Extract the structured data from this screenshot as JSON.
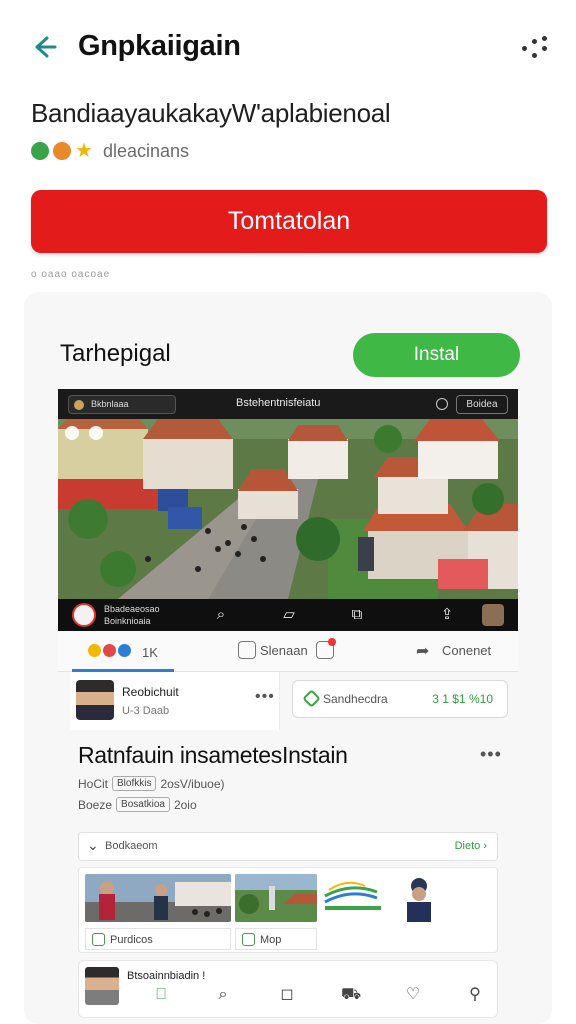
{
  "header": {
    "back_icon": "arrow-left-icon",
    "title": "Gnpkaiigain",
    "more_icon": "share-dots-icon"
  },
  "subtitle": "BandiaayaukakayW'aplabienoal",
  "meta": {
    "text": "dleacinans",
    "dots": [
      "#3aa34a",
      "#e8892a",
      "#f2b705"
    ]
  },
  "cta": {
    "label": "Tomtatolan"
  },
  "caption": "o oaao oacoae",
  "card": {
    "title": "Tarhepigal",
    "install_label": "Instal",
    "colors": {
      "install": "#3fb846",
      "cta": "#e31b1b"
    }
  },
  "media": {
    "chip_left": "Bkbnlaaa",
    "title": "Bstehentnisfeiatu",
    "chip_right": "Boidea",
    "channel_line1": "Bbadeaeosao",
    "channel_line2": "Boinknioaia",
    "icons": [
      "search-icon",
      "bookmark-icon",
      "save-icon",
      "share-icon"
    ]
  },
  "reactions": {
    "count": "1K",
    "comment_label": "Slenaan",
    "connect_label": "Conenet"
  },
  "post": {
    "author_name": "Reobichuit",
    "author_sub": "U-3 Daab",
    "shared_label": "Sandhecdra",
    "shared_count": "3 1 $1 %10"
  },
  "section": {
    "title": "Ratnfauin insametesInstain",
    "line1_prefix": "HoCit",
    "line1_tag": "Blofkkis",
    "line1_suffix": "2osV/ibuoe)",
    "line2_prefix": "Boeze",
    "line2_tag": "Bosatkioa",
    "line2_suffix": "2oio"
  },
  "dropdown": {
    "label": "Bodkaeom",
    "right": "Dieto ›"
  },
  "gallery": {
    "label1": "Purdicos",
    "label2": "Mop"
  },
  "bottom": {
    "name": "Btsoainnbiadin !",
    "icons": [
      "book-icon",
      "search-icon",
      "chat-icon",
      "car-icon",
      "heart-icon",
      "person-icon"
    ]
  }
}
